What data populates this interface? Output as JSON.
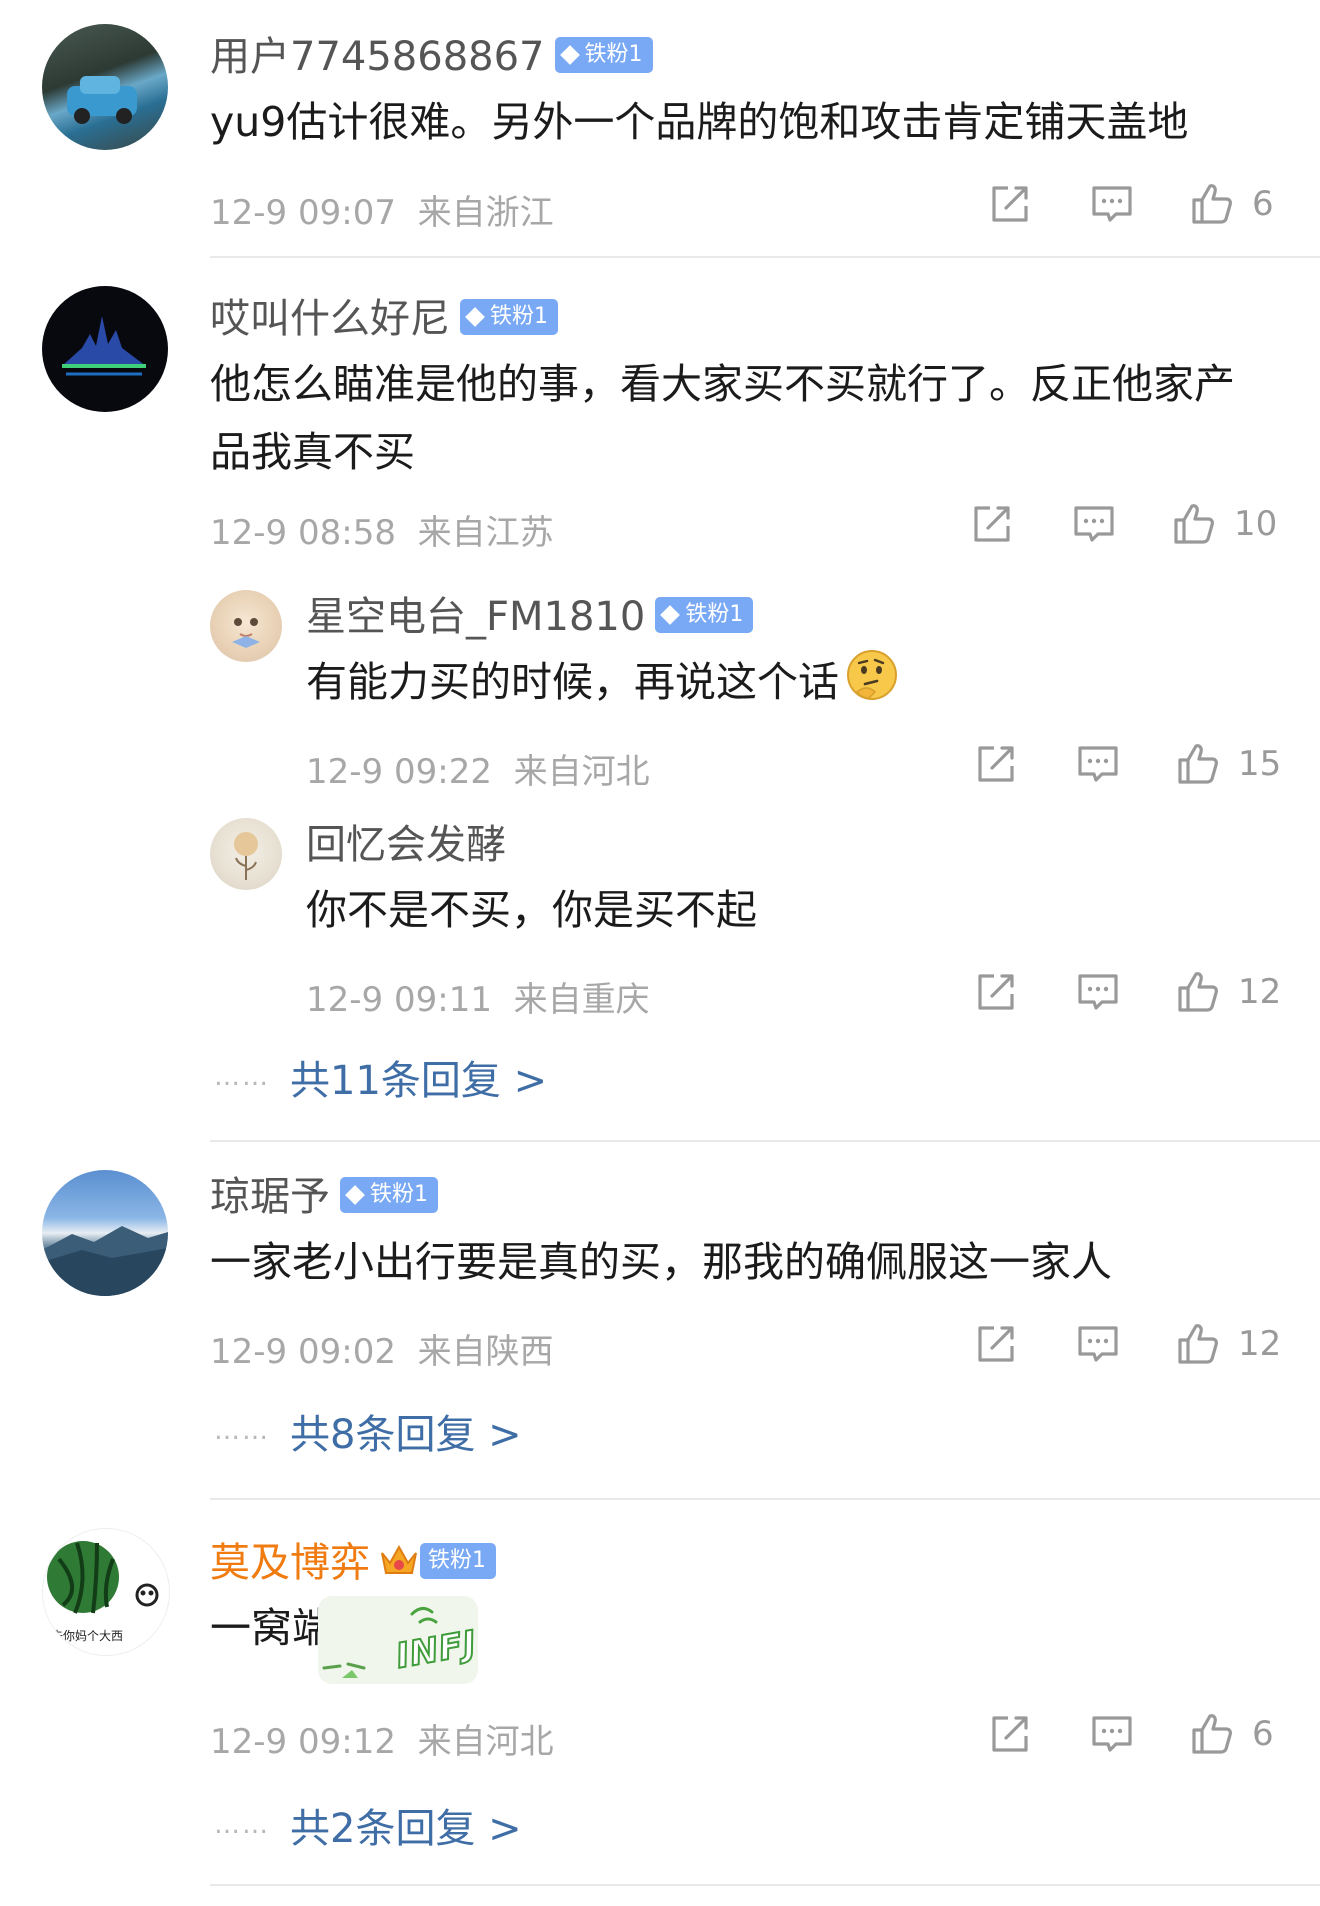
{
  "comments": [
    {
      "user": "用户7745868867",
      "badge": "铁粉1",
      "text": "yu9估计很难。另外一个品牌的饱和攻击肯定铺天盖地",
      "time": "12-9 09:07",
      "location": "来自浙江",
      "likes": "6"
    },
    {
      "user": "哎叫什么好尼",
      "badge": "铁粉1",
      "text": "他怎么瞄准是他的事，看大家买不买就行了。反正他家产品我真不买",
      "time": "12-9 08:58",
      "location": "来自江苏",
      "likes": "10",
      "replies": [
        {
          "user": "星空电台_FM1810",
          "badge": "铁粉1",
          "text": "有能力买的时候，再说这个话",
          "time": "12-9 09:22",
          "location": "来自河北",
          "likes": "15"
        },
        {
          "user": "回忆会发酵",
          "text": "你不是不买，你是买不起",
          "time": "12-9 09:11",
          "location": "来自重庆",
          "likes": "12"
        }
      ],
      "dots": "……",
      "more": "共11条回复 >"
    },
    {
      "user": "琼琚予",
      "badge": "铁粉1",
      "text": "一家老小出行要是真的买，那我的确佩服这一家人",
      "time": "12-9 09:02",
      "location": "来自陕西",
      "likes": "12",
      "dots": "……",
      "more": "共8条回复 >"
    },
    {
      "user": "莫及博弈",
      "badge": "铁粉1",
      "text": "一窝端?",
      "time": "12-9 09:12",
      "location": "来自河北",
      "likes": "6",
      "dots": "……",
      "more": "共2条回复 >",
      "avatar_caption": "去你妈个大西",
      "sticker_text": "INFJ"
    }
  ],
  "colors": {
    "name": "#555555",
    "vip_name": "#f07b10",
    "badge": "#79a9f4",
    "link": "#3f6da6",
    "meta": "#a7a7a7"
  },
  "icons": [
    "share-icon",
    "comment-icon",
    "like-icon",
    "diamond-icon",
    "crown-icon",
    "thinking-emoji"
  ]
}
